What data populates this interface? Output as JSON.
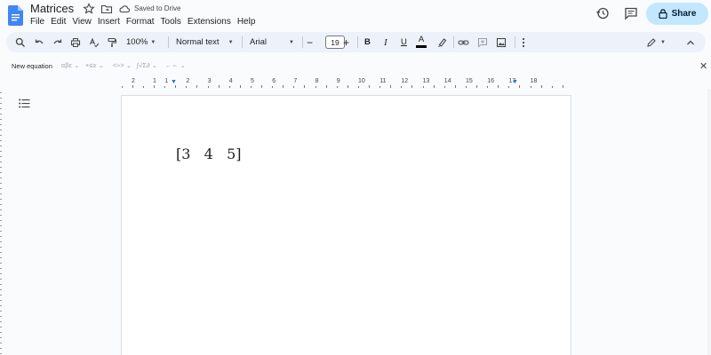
{
  "doc": {
    "title": "Matrices",
    "status": "Saved to Drive"
  },
  "menu": [
    "File",
    "Edit",
    "View",
    "Insert",
    "Format",
    "Tools",
    "Extensions",
    "Help"
  ],
  "share": {
    "label": "Share"
  },
  "toolbar": {
    "zoom": "100%",
    "style": "Normal text",
    "font": "Arial",
    "font_size": "19",
    "minus": "−",
    "plus": "+",
    "bold": "B",
    "italic": "I",
    "underline": "U",
    "text_color": "A"
  },
  "equation_bar": {
    "label": "New equation",
    "groups": [
      "αβε",
      "×≤≥",
      "<≈>",
      "∫√Σ∂",
      "←⇔"
    ],
    "close": "✕"
  },
  "ruler": {
    "numbers": [
      "2",
      "1",
      "1",
      "2",
      "3",
      "4",
      "5",
      "6",
      "7",
      "8",
      "9",
      "10",
      "11",
      "12",
      "13",
      "14",
      "15",
      "16",
      "17",
      "18"
    ]
  },
  "content": {
    "equation": "[3   4   5]"
  },
  "colors": {
    "accent": "#1a73e8",
    "share_bg": "#c2e7ff",
    "toolbar_bg": "#edf2fa",
    "doc_blue": "#4285f4"
  }
}
